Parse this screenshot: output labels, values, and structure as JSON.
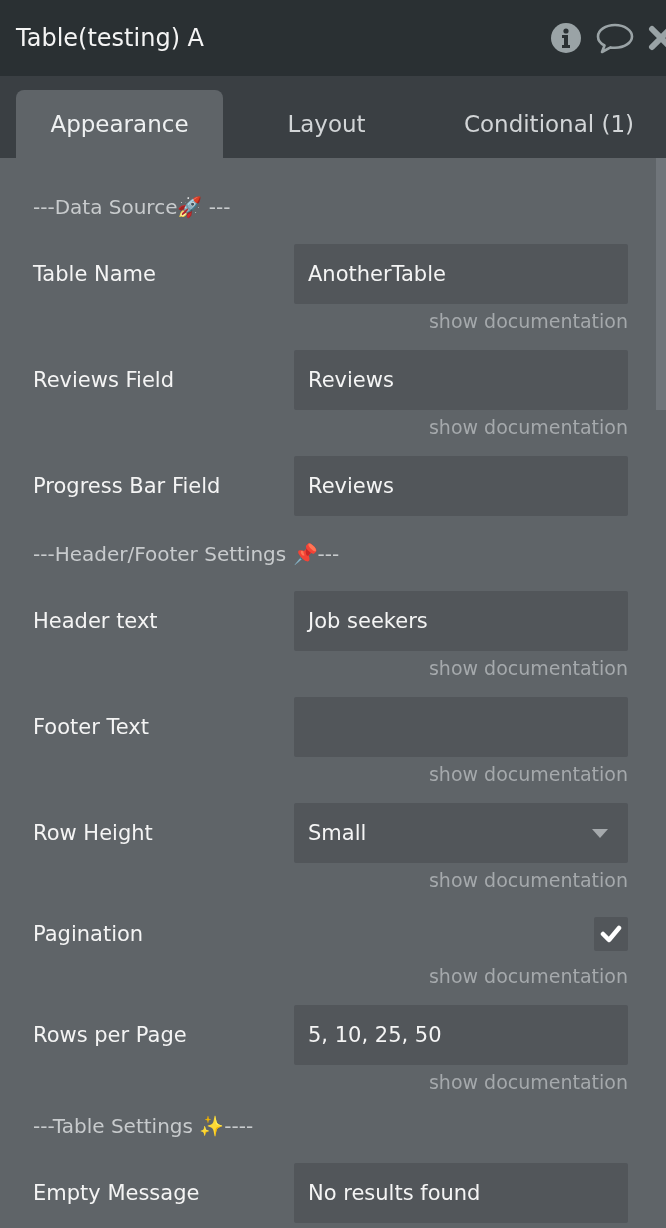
{
  "window": {
    "title": "Table(testing) A"
  },
  "tabs": [
    {
      "label": "Appearance",
      "selected": true
    },
    {
      "label": "Layout",
      "selected": false
    },
    {
      "label": "Conditional (1)",
      "selected": false
    }
  ],
  "items": [
    {
      "kind": "section",
      "label": "---Data Source🚀 ---"
    },
    {
      "kind": "text",
      "label": "Table Name",
      "value": "AnotherTable",
      "documentation": "show documentation"
    },
    {
      "kind": "text",
      "label": "Reviews Field",
      "value": "Reviews",
      "documentation": "show documentation"
    },
    {
      "kind": "text",
      "label": "Progress Bar Field",
      "value": "Reviews"
    },
    {
      "kind": "section",
      "label": "---Header/Footer Settings 📌---"
    },
    {
      "kind": "text",
      "label": "Header text",
      "value": "Job seekers",
      "documentation": "show documentation"
    },
    {
      "kind": "text",
      "label": "Footer Text",
      "documentation": "show documentation"
    },
    {
      "kind": "dropdown",
      "label": "Row Height",
      "value": "Small",
      "documentation": "show documentation"
    },
    {
      "kind": "checkbox",
      "label": "Pagination",
      "checked": true,
      "documentation": "show documentation"
    },
    {
      "kind": "text",
      "label": "Rows per Page",
      "value": "5, 10, 25, 50",
      "documentation": "show documentation"
    },
    {
      "kind": "section",
      "label": "---Table Settings ✨----"
    },
    {
      "kind": "text",
      "label": "Empty Message",
      "value": "No results found"
    }
  ]
}
